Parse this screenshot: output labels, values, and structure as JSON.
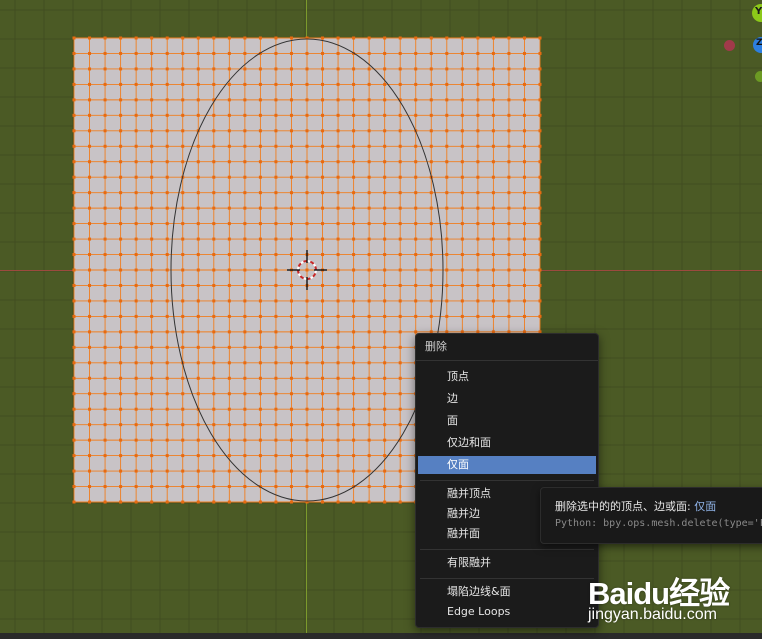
{
  "viewport": {
    "background": "#4b5a25",
    "grid_color": "#414d21",
    "x_axis_color": "#9c4a3e",
    "y_axis_color": "#7c9a2c",
    "mesh_face_color": "#c8c3c6",
    "mesh_edge_color": "#f07e1f",
    "circle_color": "#333333",
    "gizmo_y_label": "Y",
    "gizmo_z_label": "Z"
  },
  "delete_menu": {
    "title": "删除",
    "items": [
      {
        "label": "顶点"
      },
      {
        "label": "边"
      },
      {
        "label": "面"
      },
      {
        "label": "仅边和面"
      },
      {
        "label": "仅面",
        "active": true
      },
      {
        "label": "融并顶点"
      },
      {
        "label": "融并边"
      },
      {
        "label": "融并面"
      },
      {
        "label": "有限融并"
      },
      {
        "label": "塌陷边线&面"
      },
      {
        "label": "Edge Loops"
      }
    ]
  },
  "tooltip": {
    "description": "删除选中的的顶点、边或面:",
    "highlight": "仅面",
    "python": "Python: bpy.ops.mesh.delete(type='FACE')"
  },
  "watermark": {
    "logo": "Baidu经验",
    "url": "jingyan.baidu.com"
  }
}
